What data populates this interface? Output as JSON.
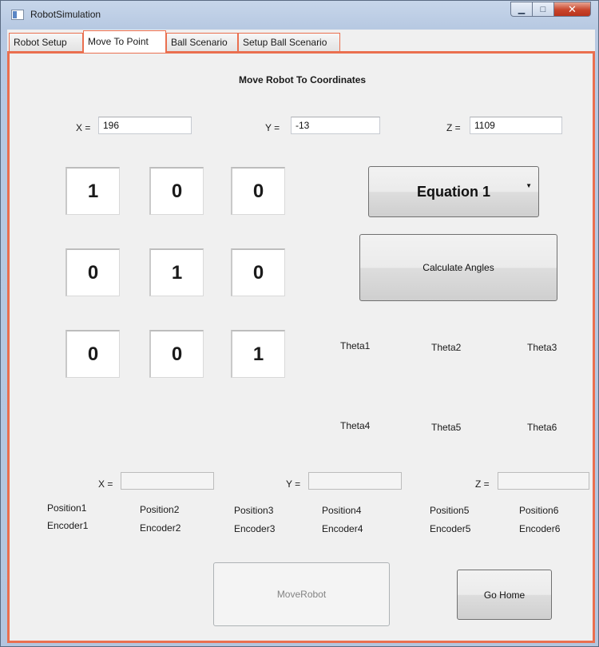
{
  "window": {
    "title": "RobotSimulation"
  },
  "tabs": [
    {
      "label": "Robot Setup"
    },
    {
      "label": "Move To Point"
    },
    {
      "label": "Ball Scenario"
    },
    {
      "label": "Setup Ball Scenario"
    }
  ],
  "active_tab": "Move To Point",
  "main": {
    "heading": "Move Robot To Coordinates",
    "coords": {
      "x_label": "X =",
      "x_value": "196",
      "y_label": "Y =",
      "y_value": "-13",
      "z_label": "Z =",
      "z_value": "1109"
    },
    "matrix": [
      [
        "1",
        "0",
        "0"
      ],
      [
        "0",
        "1",
        "0"
      ],
      [
        "0",
        "0",
        "1"
      ]
    ],
    "equation_select": {
      "selected": "Equation 1"
    },
    "calculate_button": "Calculate Angles",
    "thetas": [
      "Theta1",
      "Theta2",
      "Theta3",
      "Theta4",
      "Theta5",
      "Theta6"
    ],
    "result_coords": {
      "x_label": "X =",
      "x_value": "",
      "y_label": "Y =",
      "y_value": "",
      "z_label": "Z =",
      "z_value": ""
    },
    "positions": [
      "Position1",
      "Position2",
      "Position3",
      "Position4",
      "Position5",
      "Position6"
    ],
    "encoders": [
      "Encoder1",
      "Encoder2",
      "Encoder3",
      "Encoder4",
      "Encoder5",
      "Encoder6"
    ],
    "move_robot_button": "MoveRobot",
    "go_home_button": "Go Home"
  }
}
